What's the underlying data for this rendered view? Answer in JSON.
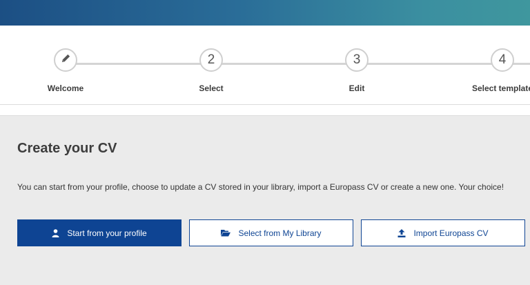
{
  "stepper": {
    "steps": [
      {
        "number": "",
        "icon": "pencil-icon",
        "label": "Welcome"
      },
      {
        "number": "2",
        "label": "Select"
      },
      {
        "number": "3",
        "label": "Edit"
      },
      {
        "number": "4",
        "label": "Select template"
      }
    ]
  },
  "main": {
    "title": "Create your CV",
    "intro": "You can start from your profile, choose to update a CV stored in your library, import a Europass CV or create a new one. Your choice!",
    "buttons": {
      "profile": {
        "label": "Start from your profile",
        "icon": "user-icon"
      },
      "library": {
        "label": "Select from My Library",
        "icon": "folder-open-icon"
      },
      "import": {
        "label": "Import Europass CV",
        "icon": "upload-icon"
      }
    }
  },
  "colors": {
    "primary": "#0e4493",
    "background": "#ebebeb",
    "header_gradient_start": "#1c4f84",
    "header_gradient_end": "#3f979e"
  }
}
